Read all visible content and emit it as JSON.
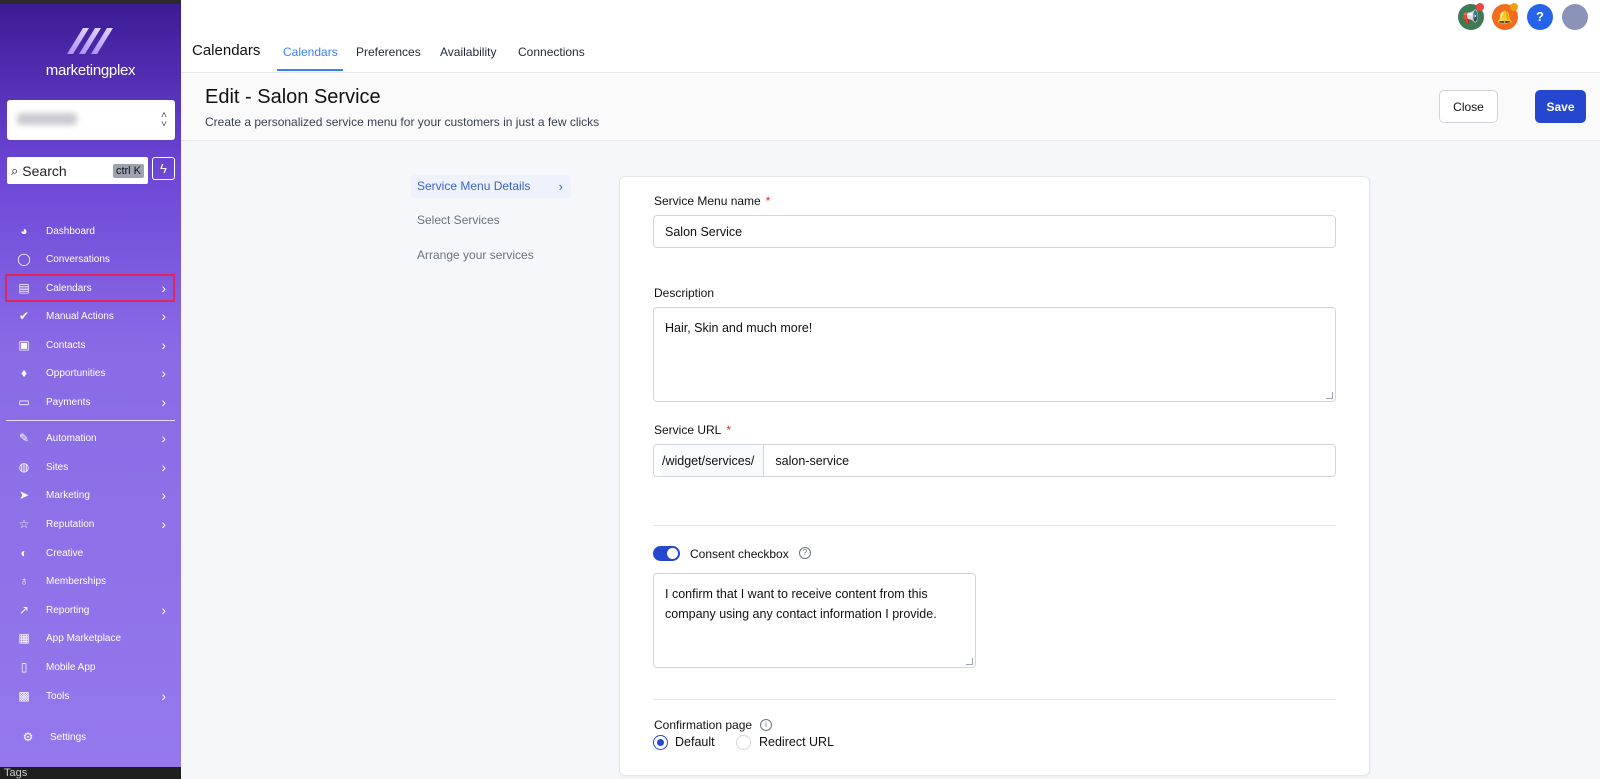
{
  "brand": {
    "name": "marketingplex"
  },
  "sidebar": {
    "search_placeholder": "Search",
    "search_shortcut": "ctrl K",
    "items": [
      {
        "label": "Dashboard",
        "icon": "dashboard-icon",
        "glyph": "◕",
        "chevron": false
      },
      {
        "label": "Conversations",
        "icon": "chat-icon",
        "glyph": "◯",
        "chevron": false
      },
      {
        "label": "Calendars",
        "icon": "calendar-icon",
        "glyph": "▤",
        "chevron": true
      },
      {
        "label": "Manual Actions",
        "icon": "check-badge-icon",
        "glyph": "✔",
        "chevron": true
      },
      {
        "label": "Contacts",
        "icon": "contacts-icon",
        "glyph": "▣",
        "chevron": true
      },
      {
        "label": "Opportunities",
        "icon": "funnel-icon",
        "glyph": "♦",
        "chevron": true
      },
      {
        "label": "Payments",
        "icon": "card-icon",
        "glyph": "▭",
        "chevron": true
      },
      {
        "label": "Automation",
        "icon": "wand-icon",
        "glyph": "✎",
        "chevron": true
      },
      {
        "label": "Sites",
        "icon": "globe-icon",
        "glyph": "◍",
        "chevron": true
      },
      {
        "label": "Marketing",
        "icon": "send-icon",
        "glyph": "➤",
        "chevron": true
      },
      {
        "label": "Reputation",
        "icon": "star-icon",
        "glyph": "☆",
        "chevron": true
      },
      {
        "label": "Creative",
        "icon": "palette-icon",
        "glyph": "◐",
        "chevron": false
      },
      {
        "label": "Memberships",
        "icon": "award-icon",
        "glyph": "♁",
        "chevron": false
      },
      {
        "label": "Reporting",
        "icon": "chart-icon",
        "glyph": "↗",
        "chevron": true
      },
      {
        "label": "App Marketplace",
        "icon": "grid-icon",
        "glyph": "▦",
        "chevron": false
      },
      {
        "label": "Mobile App",
        "icon": "phone-icon",
        "glyph": "▯",
        "chevron": false
      },
      {
        "label": "Tools",
        "icon": "toolbox-icon",
        "glyph": "▩",
        "chevron": true
      }
    ],
    "settings_label": "Settings",
    "bottom_text": "Tags"
  },
  "topbar": {
    "title": "Calendars",
    "tabs": [
      "Calendars",
      "Preferences",
      "Availability",
      "Connections"
    ],
    "active_tab": "Calendars"
  },
  "header": {
    "title": "Edit - Salon Service",
    "subtitle": "Create a personalized service menu for your customers in just a few clicks",
    "close_label": "Close",
    "save_label": "Save"
  },
  "steps": {
    "items": [
      "Service Menu Details",
      "Select Services",
      "Arrange your services"
    ],
    "active": "Service Menu Details"
  },
  "form": {
    "name_label": "Service Menu name",
    "name_value": "Salon Service",
    "description_label": "Description",
    "description_value": "Hair, Skin and much more!",
    "url_label": "Service URL",
    "url_prefix": "/widget/services/",
    "url_value": "salon-service",
    "required_mark": "*",
    "consent_label": "Consent checkbox",
    "consent_enabled": true,
    "consent_text": "I confirm that I want to receive content from this company using any contact information I provide.",
    "confirmation_label": "Confirmation page",
    "confirmation_options": [
      "Default",
      "Redirect URL"
    ],
    "confirmation_selected": "Default"
  },
  "colors": {
    "primary": "#2547d0",
    "tab_active": "#3b82f6",
    "sidebar_top": "#3b1a93",
    "sidebar_bottom": "#9478ec",
    "highlight": "#e0245e"
  }
}
